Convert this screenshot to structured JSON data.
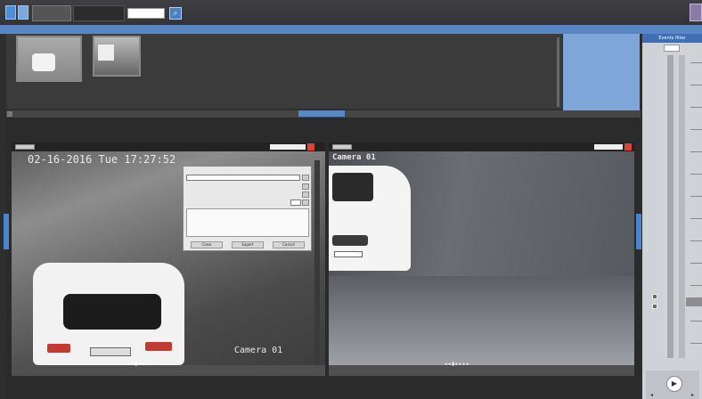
{
  "toolbar": {
    "tabs": [
      {
        "label": ""
      },
      {
        "label": ""
      }
    ],
    "camera_select": "",
    "search_icon": "magnifier-icon",
    "user_icon": "user-icon"
  },
  "info_strip": {
    "text": ""
  },
  "thumbnails": [
    {
      "caption": ""
    },
    {
      "caption": ""
    }
  ],
  "timeline": {
    "header": "Events filter",
    "ticks": [
      "",
      "",
      "",
      "",
      "",
      "",
      "",
      "",
      "",
      "",
      "",
      "",
      ""
    ]
  },
  "section_button": "",
  "video1": {
    "timestamp": "02-16-2016 Tue 17:27:52",
    "camera_label": "Camera 01"
  },
  "video2": {
    "camera_label": "Camera 01"
  },
  "dialog": {
    "title": "",
    "path": "",
    "rows": [
      {
        "label": "",
        "value": ""
      },
      {
        "label": "",
        "value": ""
      },
      {
        "label": "",
        "value": ""
      }
    ],
    "buttons": [
      "Close",
      "Export",
      "Cancel"
    ]
  },
  "timeline_bottom": {
    "label": ""
  },
  "colors": {
    "accent": "#5a86c4",
    "background": "#2e2e2e"
  }
}
